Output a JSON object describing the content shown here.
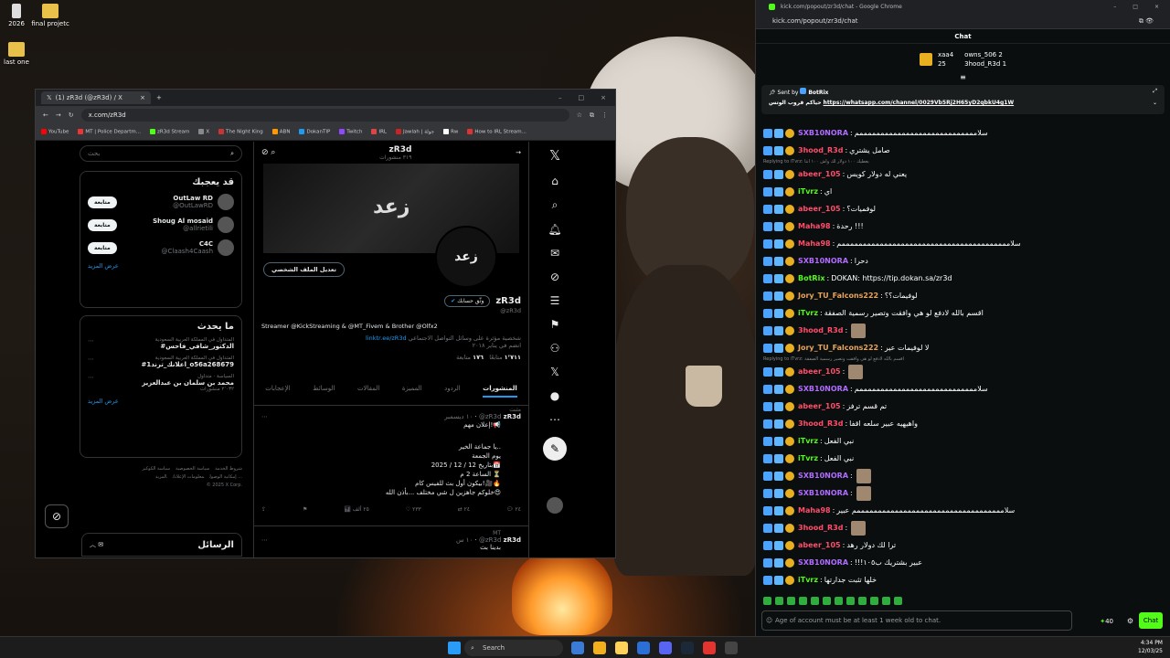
{
  "desktop": {
    "icons": [
      {
        "label": "2026"
      },
      {
        "label": "final projetc"
      },
      {
        "label": "last one"
      }
    ]
  },
  "x_window": {
    "tab_title": "(1) zR3d (@zR3d) / X",
    "url": "x.com/zR3d",
    "bookmarks": [
      "YouTube",
      "MT | Police Departm...",
      "zR3d Stream",
      "X",
      "The Night King",
      "ABN",
      "DokanTIP",
      "Twitch",
      "IRL",
      "Jawlah | جولة",
      "Rw",
      "How to IRL Stream..."
    ],
    "search_placeholder": "بحث",
    "who_to_follow": {
      "title": "قد يعجبك",
      "follow_label": "متابعة",
      "more": "عرض المزيد",
      "users": [
        {
          "name": "OutLaw RD",
          "handle": "@OutLawRD"
        },
        {
          "name": "Shoug Al mosaid",
          "handle": "@allrietili"
        },
        {
          "name": "C4C",
          "handle": "@Claash4Caash"
        }
      ]
    },
    "trending": {
      "title": "ما يحدث",
      "more": "عرض المزيد",
      "items": [
        {
          "context": "المتداول في المملكة العربية السعودية",
          "topic": "#الدكتور_شافي_فاحس"
        },
        {
          "context": "المتداول في المملكة العربية السعودية",
          "topic": "#اعلانك_ترند1_o56a268679"
        },
        {
          "context": "السياسة · متداول",
          "topic": "محمد بن سلمان بن عبدالعزيز",
          "count": "٢٬٠٣٢ منشورات"
        }
      ]
    },
    "footer": [
      "شروط الخدمة",
      "سياسة الخصوصية",
      "سياسة الكوكيز",
      "إمكانية الوصول",
      "معلومات الإعلانات",
      "المزيد ...",
      "© 2025 X Corp."
    ],
    "profile": {
      "name": "zR3d",
      "post_count": "٣١٩ منشورات",
      "handle": "@zR3d",
      "edit_button": "تعديل الملف الشخصي",
      "verify_button": "وثّق حسابك",
      "bio": "Streamer @KickStreaming & @MT_Fivem & Brother @Olfx2",
      "link": "linktr.ee/zR3d",
      "category": "شخصية مؤثرة على وسائل التواصل الاجتماعي",
      "joined": "انضم في يناير ٢٠١٨",
      "following": "١٧٦",
      "following_label": "متابعة",
      "followers": "١٬٧١١",
      "followers_label": "متابعًا"
    },
    "tabs": [
      "المنشورات",
      "الردود",
      "المميزة",
      "المقالات",
      "الوسائط",
      "الإعجابات"
    ],
    "pinned_label": "مثبت",
    "post1": {
      "name": "zR3d",
      "handle": "@zR3d",
      "date": "١٠ ديسمبر",
      "lines": [
        "إعلان مهم!📢",
        "يا جماعة الخير..",
        "يوم الجمعة",
        "بتاريخ 12 / 12 / 2025📅",
        "الساعة 2 م ⏳",
        "بيكون أول بث للفيس كام!🎥🔥",
        "خلوكم جاهزين ل شي مختلف ...بأذن الله😍"
      ],
      "stats": {
        "replies": "٢٤",
        "reposts": "٢٤",
        "likes": "٢٣٣",
        "views": "٢٥ ألف"
      }
    },
    "post2": {
      "context": "MT",
      "name": "zR3d",
      "handle": "@zR3d",
      "time": "١٠ س",
      "text": "بدينا بث"
    },
    "messages_label": "الرسائل"
  },
  "chat_window": {
    "title": "kick.com/popout/zr3d/chat - Google Chrome",
    "url": "kick.com/popout/zr3d/chat",
    "header": "Chat",
    "gifters": [
      {
        "name": "xaa4",
        "count": "25"
      },
      {
        "name": "owns_506",
        "count": "2"
      },
      {
        "name": "3hood_R3d",
        "count": "1"
      }
    ],
    "pinned": {
      "sent_by": "Sent by",
      "sender": "BotRix",
      "prefix": "حياكم قروب الوتس",
      "link": "https://whatsapp.com/channel/0029Vb5Rj2H65yD2qbkU4g1W"
    },
    "messages": [
      {
        "user": "SXB10NORA",
        "color": "#b06cff",
        "text": "سلاممممممممممممممممممممممممممممم"
      },
      {
        "user": "3hood_R3d",
        "color": "#ff4d6a",
        "text": "صامل يشتري"
      },
      {
        "reply": "Replying to iTvrz: يعطيك ١٠٠ دولار لك واش ١٠٠ انتا"
      },
      {
        "user": "abeer_105",
        "color": "#ff4d6a",
        "text": "يعني له دولار كويس"
      },
      {
        "user": "iTvrz",
        "color": "#53fc18",
        "text": "اي"
      },
      {
        "user": "abeer_105",
        "color": "#ff4d6a",
        "text": "لوفميات؟"
      },
      {
        "user": "Maha98",
        "color": "#ff4d6a",
        "text": "رحدة !!!"
      },
      {
        "user": "Maha98",
        "color": "#ff4d6a",
        "text": "سلاممممممممممممممممممممممممممممممممممممممممم"
      },
      {
        "user": "SXB10NORA",
        "color": "#b06cff",
        "text": "دحرا"
      },
      {
        "user": "BotRix",
        "color": "#53fc18",
        "text": "DOKAN: https://tip.dokan.sa/zr3d"
      },
      {
        "user": "Jory_TU_Falcons222",
        "color": "#e8a45a",
        "text": "لوفيمات؟؟"
      },
      {
        "user": "iTvrz",
        "color": "#53fc18",
        "text": "اقسم بالله لادفع لو هي وافقت وتصير رسمية الصفقة"
      },
      {
        "user": "3hood_R3d",
        "color": "#ff4d6a",
        "text": ""
      },
      {
        "user": "Jory_TU_Falcons222",
        "color": "#e8a45a",
        "text": "لا لوفيمات عير"
      },
      {
        "reply": "Replying to iTvrz: اقسم بالله لادفع لو هي وافقت وتصير رسمية الصفقة"
      },
      {
        "user": "abeer_105",
        "color": "#ff4d6a",
        "text": ""
      },
      {
        "user": "SXB10NORA",
        "color": "#b06cff",
        "text": "سلاممممممممممممممممممممممممممممم"
      },
      {
        "user": "abeer_105",
        "color": "#ff4d6a",
        "text": "تم قسم ترفز"
      },
      {
        "user": "3hood_R3d",
        "color": "#ff4d6a",
        "text": "واهيهيه عبير سلعه اقفا"
      },
      {
        "user": "iTvrz",
        "color": "#53fc18",
        "text": "نبي الفعل"
      },
      {
        "user": "iTvrz",
        "color": "#53fc18",
        "text": "نبي الفعل"
      },
      {
        "user": "SXB10NORA",
        "color": "#b06cff",
        "text": ""
      },
      {
        "user": "SXB10NORA",
        "color": "#b06cff",
        "text": ""
      },
      {
        "user": "Maha98",
        "color": "#ff4d6a",
        "text": "سلامممممممممممممممممممممممممممممممممممم عبير"
      },
      {
        "user": "3hood_R3d",
        "color": "#ff4d6a",
        "text": ""
      },
      {
        "user": "abeer_105",
        "color": "#ff4d6a",
        "text": "ترا لك دولار رهد"
      },
      {
        "user": "SXB10NORA",
        "color": "#b06cff",
        "text": "!!!عبير بشتريك ب١٠٥"
      },
      {
        "user": "iTvrz",
        "color": "#53fc18",
        "text": "خلها تثبت جدارتها"
      }
    ],
    "input_placeholder": "Age of account must be at least 1 week old to chat.",
    "points": "40",
    "send_button": "Chat"
  },
  "taskbar": {
    "search": "Search",
    "time": "4:34 PM",
    "date": "12/03/25"
  },
  "colors": {
    "kick_green": "#53fc18",
    "x_blue": "#1d9bf0"
  }
}
